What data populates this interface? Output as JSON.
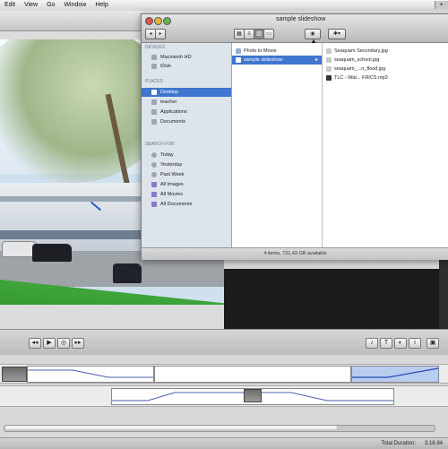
{
  "menubar": {
    "items": [
      "Edit",
      "View",
      "Go",
      "Window",
      "Help"
    ]
  },
  "finder": {
    "title": "sample slideshow",
    "sidebar": {
      "devices_label": "DEVICES",
      "devices": [
        "Macintosh HD",
        "iDisk"
      ],
      "places_label": "PLACES",
      "places": [
        "Desktop",
        "teacher",
        "Applications",
        "Documents"
      ],
      "search_label": "SEARCH FOR",
      "search": [
        "Today",
        "Yesterday",
        "Past Week",
        "All Images",
        "All Movies",
        "All Documents"
      ]
    },
    "column1": [
      "Photo to Movie",
      "sample slideshow"
    ],
    "column2": [
      "Seaquam Secondary.jpg",
      "seaquam_school.jpg",
      "seaquam_...n_flood.jpg",
      "TLC - Wat... FRICS.mp3"
    ],
    "status": "4 items, 731.43 GB available"
  },
  "statusbar": {
    "label": "Total Duration:",
    "value": "3:18.94"
  },
  "icons": {
    "playback": [
      "rewind-icon",
      "play-icon",
      "loop-icon",
      "forward-icon"
    ],
    "tools": [
      "audio-icon",
      "text-icon",
      "effect-icon",
      "info-icon"
    ]
  }
}
